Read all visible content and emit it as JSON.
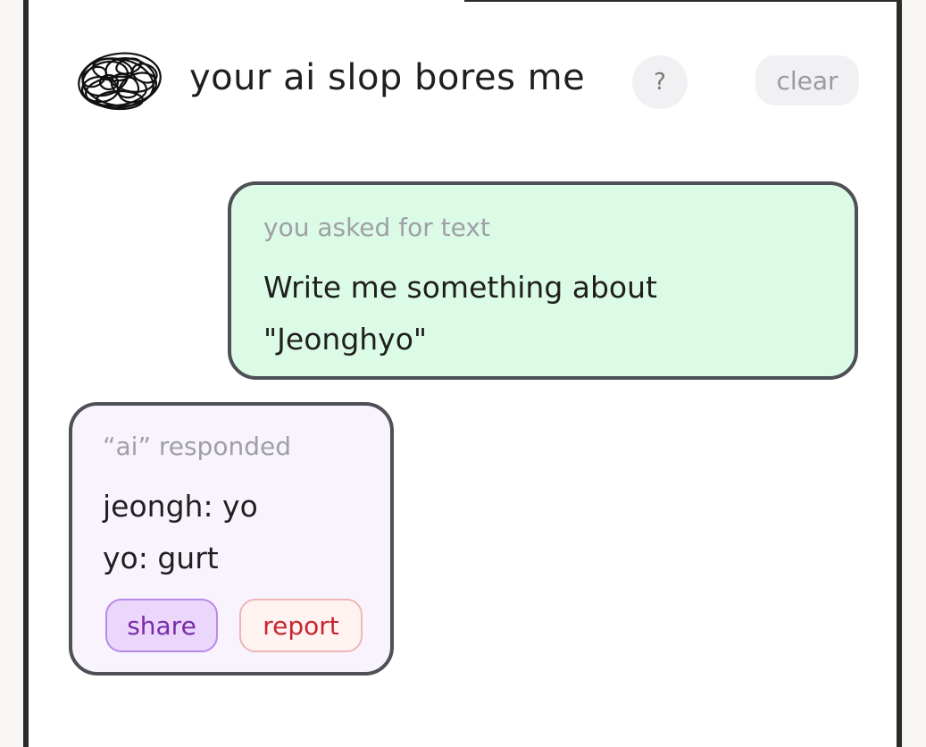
{
  "header": {
    "title": "your ai slop bores me",
    "help_label": "?",
    "clear_label": "clear",
    "logo_icon": "scribble-logo-icon"
  },
  "conversation": {
    "user_message": {
      "meta": "you asked for text",
      "lines": [
        "Write me something about",
        "\"Jeonghyo\""
      ]
    },
    "ai_message": {
      "meta": "“ai” responded",
      "lines": [
        "jeongh: yo",
        "yo: gurt"
      ],
      "share_label": "share",
      "report_label": "report"
    }
  },
  "colors": {
    "user_bubble": "#dcfbe6",
    "ai_bubble": "#f9f3fe",
    "bubble_border": "#4e5058",
    "share": "#7a2ca8",
    "report": "#c72630"
  }
}
